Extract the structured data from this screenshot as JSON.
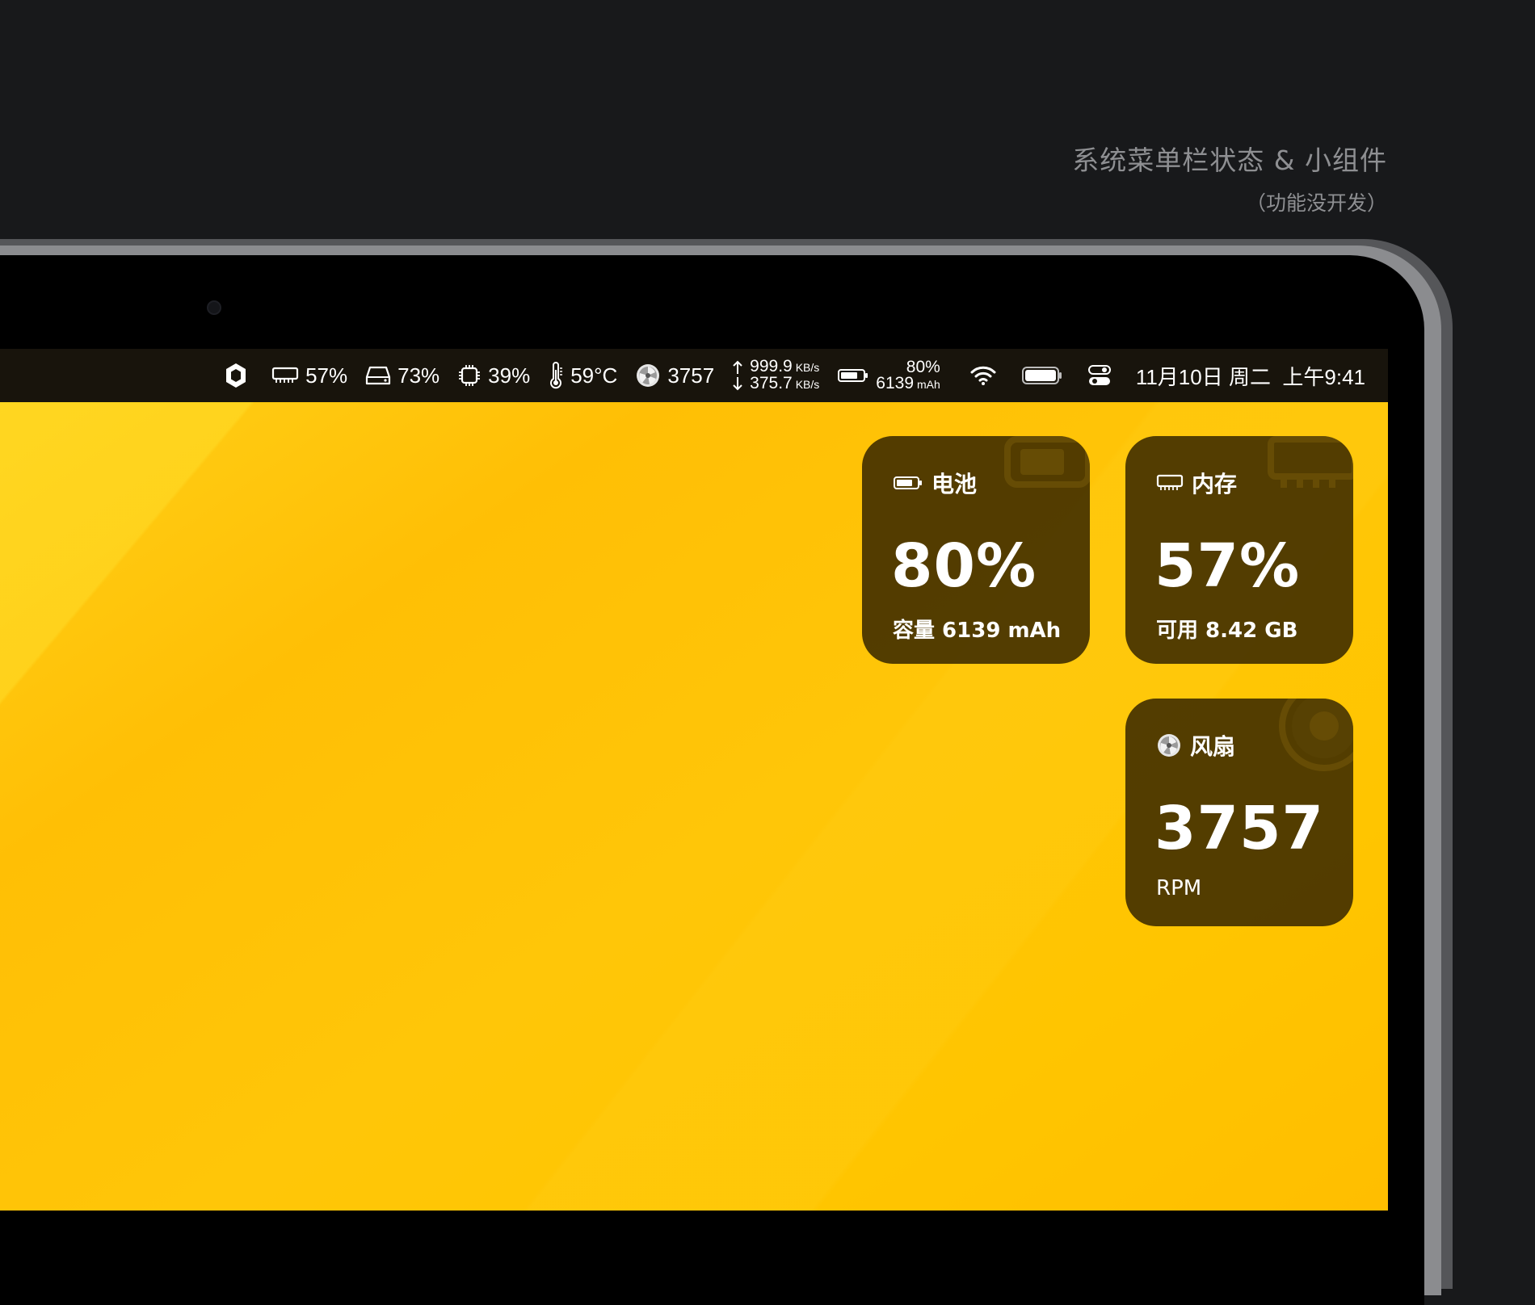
{
  "caption": {
    "title": "系统菜单栏状态 & 小组件",
    "subtitle": "（功能没开发）"
  },
  "menubar": {
    "memory": "57%",
    "disk": "73%",
    "cpu": "39%",
    "temperature": "59°C",
    "fan": "3757",
    "net_up": "999.9",
    "net_down": "375.7",
    "net_unit": "KB/s",
    "battery_percent": "80%",
    "battery_capacity": "6139",
    "battery_unit": "mAh",
    "datetime": "11月10日 周二  上午9:41"
  },
  "widgets": {
    "battery": {
      "title": "电池",
      "value": "80%",
      "sub": "容量 6139 mAh"
    },
    "memory": {
      "title": "内存",
      "value": "57%",
      "sub": "可用 8.42 GB"
    },
    "fan": {
      "title": "风扇",
      "value": "3757",
      "sub": "RPM"
    }
  },
  "colors": {
    "background": "#18191b",
    "wallpaper": "#ffc500",
    "widget": "#402e00",
    "menubar": "#18140c"
  }
}
